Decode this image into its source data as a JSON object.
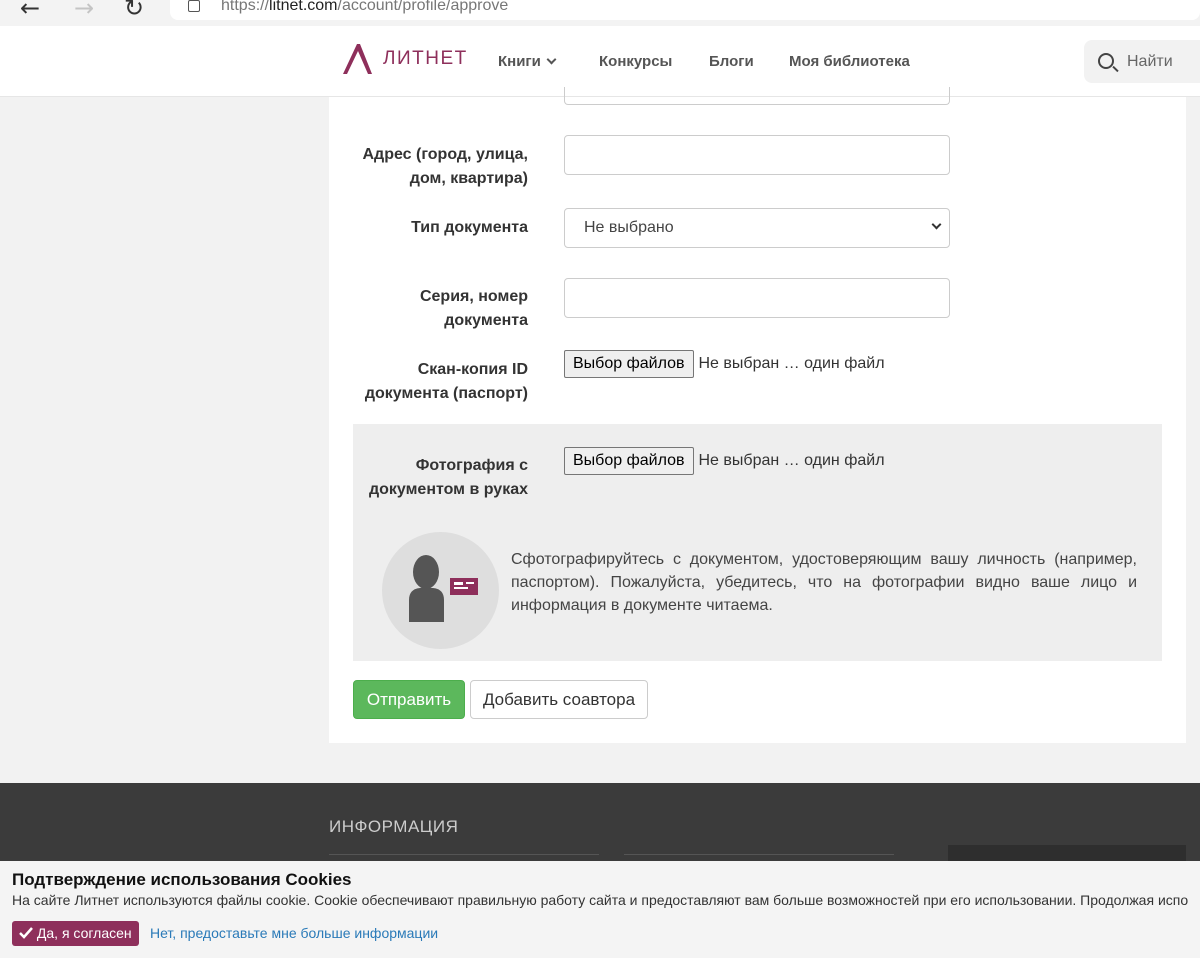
{
  "browser": {
    "url_prefix": "https://",
    "url_host": "litnet.com",
    "url_path": "/account/profile/approve"
  },
  "header": {
    "logo_text": "ЛИТНЕТ",
    "menu": {
      "books": "Книги",
      "contests": "Конкурсы",
      "blogs": "Блоги",
      "library": "Моя библиотека"
    },
    "search_label": "Найти"
  },
  "form": {
    "address_label": "Адрес (город, улица, дом, квартира)",
    "address_value": "",
    "doc_type_label": "Тип документа",
    "doc_type_value": "Не выбрано",
    "series_label": "Серия, номер документа",
    "series_value": "",
    "scan_label": "Скан-копия ID документа (паспорт)",
    "photo_label": "Фотография с документом в руках",
    "file_button": "Выбор файлов",
    "file_status": "Не выбран … один файл",
    "photo_hint": "Сфотографируйтесь с документом, удостоверяющим вашу личность (например, паспортом). Пожалуйста, убедитесь, что на фотографии видно ваше лицо и информация в документе читаема.",
    "submit": "Отправить",
    "add_coauthor": "Добавить соавтора"
  },
  "footer": {
    "title": "ИНФОРМАЦИЯ"
  },
  "cookie": {
    "title": "Подтверждение использования Cookies",
    "text": "На сайте Литнет используются файлы cookie. Cookie обеспечивают правильную работу сайта и предоставляют вам больше возможностей при его использовании. Продолжая испо",
    "accept": "Да, я согласен",
    "more": "Нет, предоставьте мне больше информации"
  },
  "colors": {
    "brand": "#8e2f5b",
    "submit_green": "#5cb85c",
    "link_blue": "#2a7ab8"
  }
}
